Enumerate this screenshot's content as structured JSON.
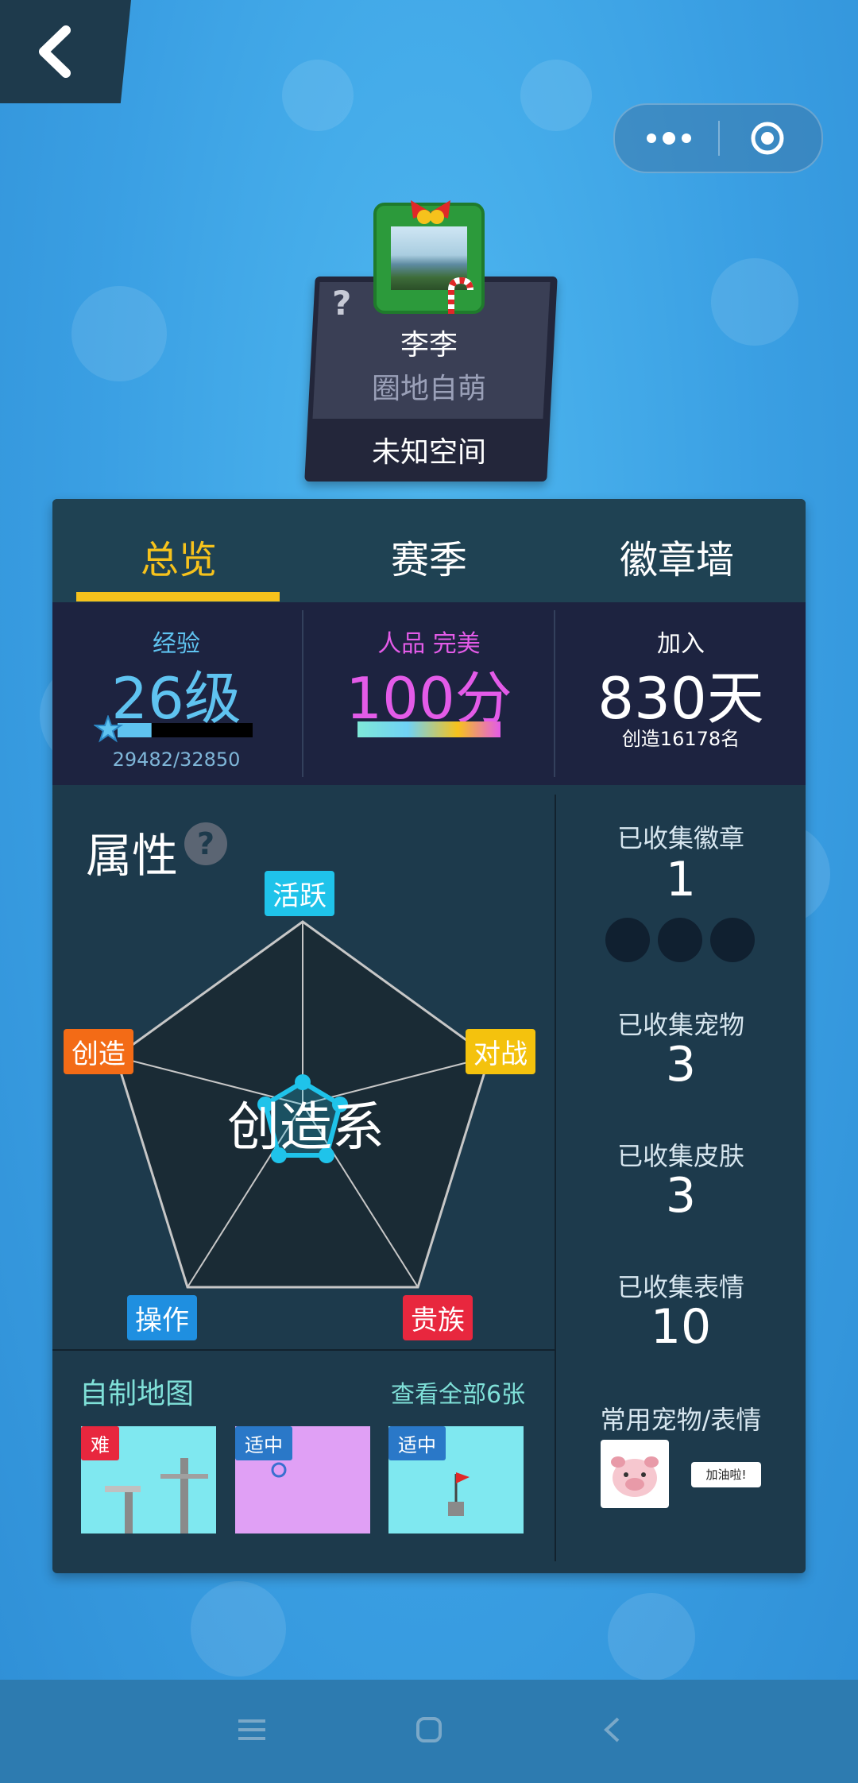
{
  "header": {
    "back_icon": "back-chevron-icon",
    "more_icon": "more-dots-icon",
    "close_icon": "target-circle-icon"
  },
  "profile": {
    "help": "?",
    "name": "李李",
    "title": "圈地自萌",
    "space": "未知空间"
  },
  "tabs": [
    {
      "label": "总览",
      "active": true
    },
    {
      "label": "赛季",
      "active": false
    },
    {
      "label": "徽章墙",
      "active": false
    }
  ],
  "stats": {
    "exp": {
      "label": "经验",
      "value": "26级",
      "progress_text": "29482/32850",
      "progress": 0.897
    },
    "karma": {
      "label": "人品 完美",
      "value": "100分"
    },
    "joined": {
      "label": "加入",
      "value": "830天",
      "sub": "创造16178名"
    }
  },
  "attributes": {
    "title": "属性",
    "help": "?",
    "center_text": "创造系",
    "axes": [
      {
        "label": "活跃",
        "color": "#1fc3ea"
      },
      {
        "label": "对战",
        "color": "#f4c20d"
      },
      {
        "label": "贵族",
        "color": "#e8273e"
      },
      {
        "label": "操作",
        "color": "#1f8fe0"
      },
      {
        "label": "创造",
        "color": "#f36b16"
      }
    ]
  },
  "collections": [
    {
      "label": "已收集徽章",
      "value": "1"
    },
    {
      "label": "已收集宠物",
      "value": "3"
    },
    {
      "label": "已收集皮肤",
      "value": "3"
    },
    {
      "label": "已收集表情",
      "value": "10"
    }
  ],
  "common": {
    "label": "常用宠物/表情",
    "emote_text": "加油啦!"
  },
  "maps": {
    "title": "自制地图",
    "view_all": "查看全部6张",
    "items": [
      {
        "tag": "难",
        "tag_color": "#e8273e"
      },
      {
        "tag": "适中",
        "tag_color": "#2a78c8"
      },
      {
        "tag": "适中",
        "tag_color": "#2a78c8"
      }
    ]
  },
  "navbar": {
    "menu_icon": "menu-icon",
    "home_icon": "home-icon",
    "back_icon": "nav-back-icon"
  }
}
